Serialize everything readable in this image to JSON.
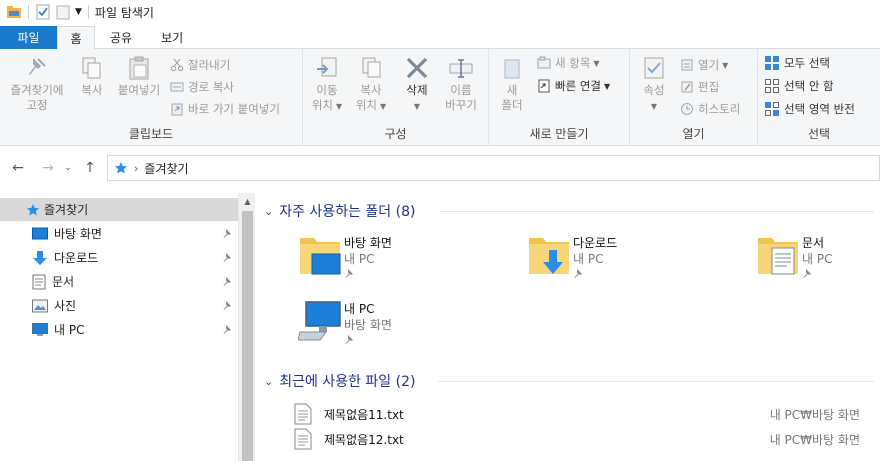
{
  "window": {
    "title": "파일 탐색기"
  },
  "tabs": [
    {
      "label": "파일"
    },
    {
      "label": "홈"
    },
    {
      "label": "공유"
    },
    {
      "label": "보기"
    }
  ],
  "ribbon": {
    "clipboard": {
      "label": "클립보드",
      "pin_quick_line1": "즐겨찾기에",
      "pin_quick_line2": "고정",
      "copy": "복사",
      "paste": "붙여넣기",
      "cut": "잘라내기",
      "copy_path": "경로 복사",
      "paste_shortcut": "바로 가기 붙여넣기"
    },
    "organize": {
      "label": "구성",
      "move_to_line1": "이동",
      "move_to_line2": "위치",
      "copy_to_line1": "복사",
      "copy_to_line2": "위치",
      "delete": "삭제",
      "rename_line1": "이름",
      "rename_line2": "바꾸기"
    },
    "new": {
      "label": "새로 만들기",
      "new_folder_line1": "새",
      "new_folder_line2": "폴더",
      "new_item": "새 항목",
      "easy_access": "빠른 연결"
    },
    "open": {
      "label": "열기",
      "properties": "속성",
      "open": "열기",
      "edit": "편집",
      "history": "히스토리"
    },
    "select": {
      "label": "선택",
      "select_all": "모두 선택",
      "select_none": "선택 안 함",
      "invert": "선택 영역 반전"
    }
  },
  "address": {
    "path": "즐겨찾기"
  },
  "nav_pane": {
    "items": [
      {
        "label": "즐겨찾기"
      },
      {
        "label": "바탕 화면"
      },
      {
        "label": "다운로드"
      },
      {
        "label": "문서"
      },
      {
        "label": "사진"
      },
      {
        "label": "내 PC"
      }
    ]
  },
  "content": {
    "frequent": {
      "header": "자주 사용하는 폴더 (8)",
      "items": [
        {
          "name": "바탕 화면",
          "location": "내 PC"
        },
        {
          "name": "다운로드",
          "location": "내 PC"
        },
        {
          "name": "문서",
          "location": "내 PC"
        },
        {
          "name": "내 PC",
          "location": "바탕 화면"
        }
      ]
    },
    "recent": {
      "header": "최근에 사용한 파일 (2)",
      "items": [
        {
          "name": "제목없음11.txt",
          "location": "내 PC₩바탕 화면"
        },
        {
          "name": "제목없음12.txt",
          "location": "내 PC₩바탕 화면"
        }
      ]
    }
  },
  "colors": {
    "accent": "#1979ca",
    "section_header": "#1e3287",
    "folder": "#f0c44f",
    "selection": "#d9d9d9"
  }
}
